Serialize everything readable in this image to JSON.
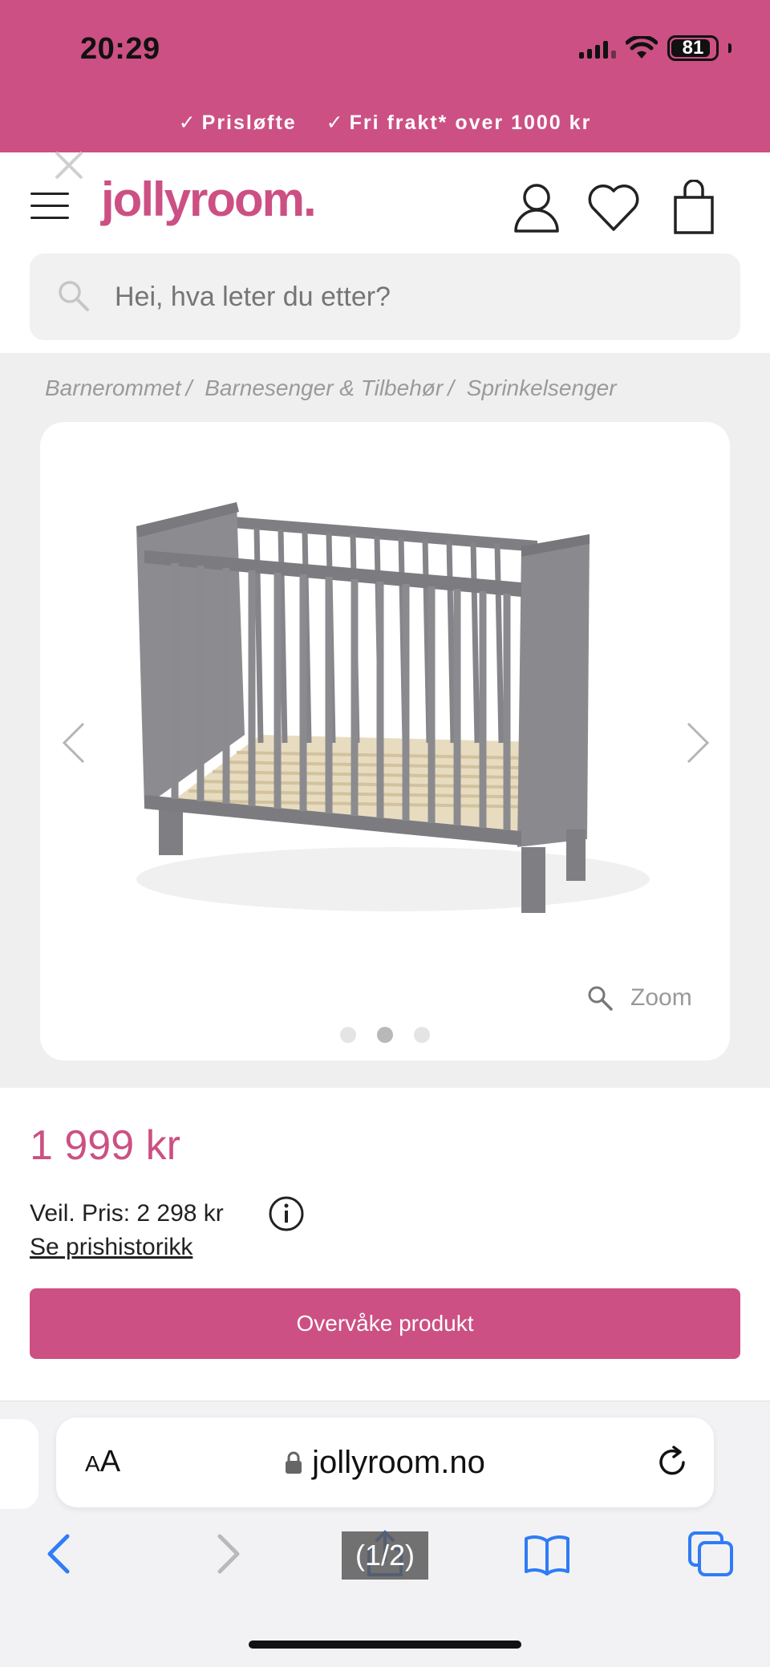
{
  "status_bar": {
    "time": "20:29",
    "battery": "81"
  },
  "promo": {
    "items": [
      "Prisløfte",
      "Fri frakt* over 1000 kr"
    ]
  },
  "header": {
    "logo": "jollyroom."
  },
  "search": {
    "placeholder": "Hei, hva leter du etter?"
  },
  "breadcrumb": [
    "Barnerommet",
    "Barnesenger & Tilbehør",
    "Sprinkelsenger"
  ],
  "gallery": {
    "zoom_label": "Zoom",
    "dot_count": 3,
    "active_dot": 2
  },
  "product": {
    "price": "1 999 kr",
    "recommended_price": "Veil. Pris: 2 298 kr",
    "price_history_link": "Se prishistorikk",
    "watch_button": "Overvåke produkt"
  },
  "browser": {
    "text_size_label": "AA",
    "url": "jollyroom.no",
    "page_counter": "(1/2)"
  },
  "colors": {
    "brand": "#cc5083",
    "accent_blue": "#2f7cf6"
  },
  "icons": [
    "close-icon",
    "menu-icon",
    "user-icon",
    "heart-icon",
    "bag-icon",
    "search-icon",
    "chevron-left-icon",
    "chevron-right-icon",
    "zoom-icon",
    "info-icon",
    "lock-icon",
    "reload-icon",
    "back-icon",
    "forward-icon",
    "share-icon",
    "bookmarks-icon",
    "tabs-icon"
  ]
}
